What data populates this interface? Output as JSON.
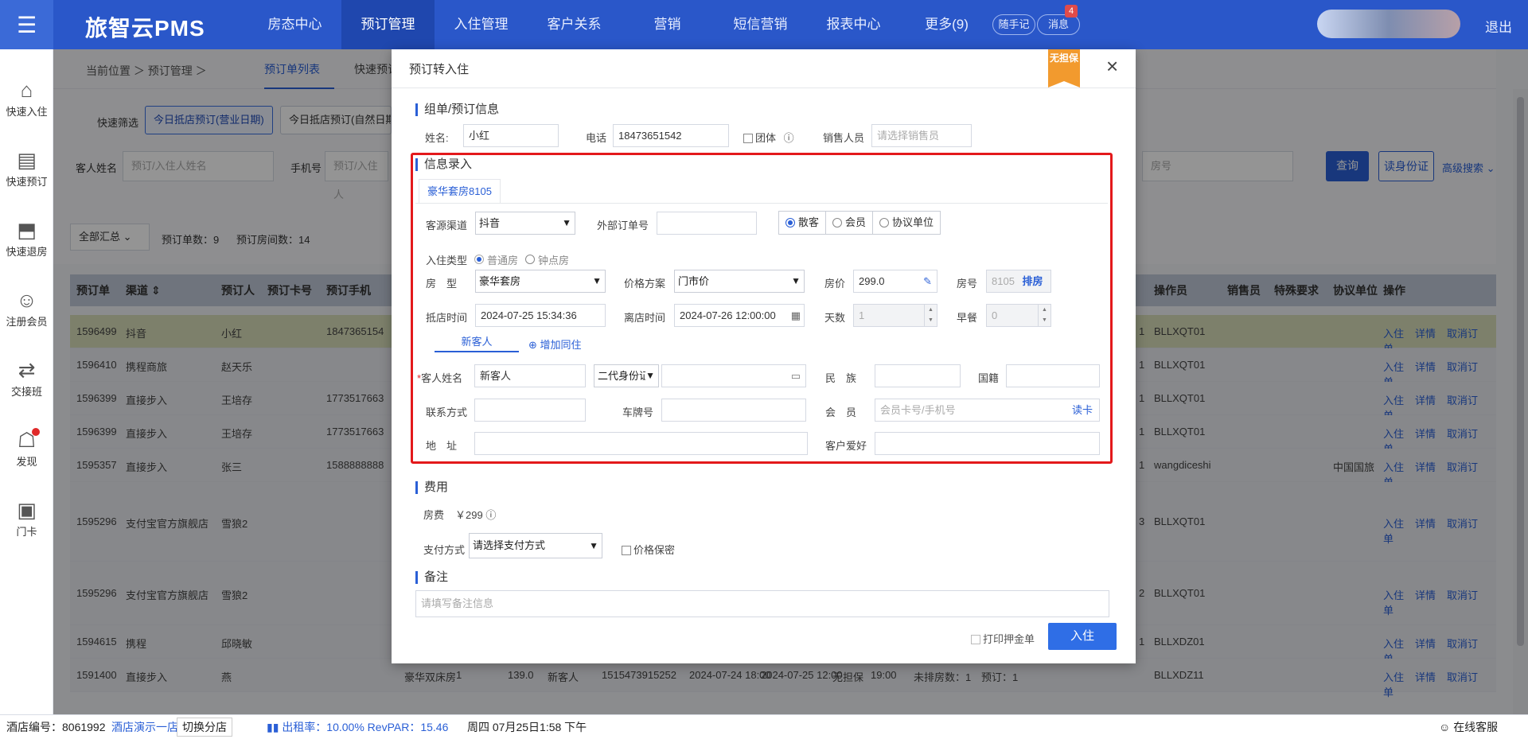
{
  "topbar": {
    "logo": "旅智云PMS",
    "nav": [
      "房态中心",
      "预订管理",
      "入住管理",
      "客户关系",
      "营销",
      "短信营销",
      "报表中心",
      "更多(9)"
    ],
    "memo_label": "随手记",
    "notice_label": "消息",
    "notice_count": "4",
    "logout_label": "退出"
  },
  "sidebar": {
    "items": [
      {
        "label": "快速入住",
        "icon": "home-icon"
      },
      {
        "label": "快速预订",
        "icon": "document-icon"
      },
      {
        "label": "快速退房",
        "icon": "checkout-icon"
      },
      {
        "label": "注册会员",
        "icon": "user-icon"
      },
      {
        "label": "交接班",
        "icon": "shift-icon"
      },
      {
        "label": "发现",
        "icon": "discover-icon"
      },
      {
        "label": "门卡",
        "icon": "card-icon"
      }
    ]
  },
  "breadcrumb": {
    "text": "当前位置 ＞ 预订管理 ＞",
    "tab_active": "预订单列表",
    "tab_other": "快速预订"
  },
  "filters": {
    "quick_label": "快速筛选",
    "btn1": "今日抵店预订(营业日期)",
    "btn2": "今日抵店预订(自然日期",
    "guest_label": "客人姓名",
    "guest_placeholder": "预订/入住人姓名",
    "phone_label": "手机号",
    "phone_placeholder": "预订/入住人",
    "room_placeholder": "房号",
    "query_label": "查询",
    "idcard_label": "读身份证",
    "advanced_label": "高级搜索",
    "summary_select": "全部汇总",
    "order_count": "预订单数：9",
    "room_count": "预订房间数：14"
  },
  "table": {
    "headers_left": [
      "预订单",
      "渠道",
      "预订人",
      "预订卡号",
      "预订手机"
    ],
    "headers_right": [
      "操作员",
      "销售员",
      "特殊要求",
      "协议单位",
      "操作"
    ],
    "op_labels": [
      "入住",
      "详情",
      "取消订单"
    ],
    "rows": [
      {
        "id": "1596499",
        "channel": "抖音",
        "name": "小红",
        "phone": "1847365154",
        "count": "1",
        "operator": "BLLXQT01",
        "agreement": ""
      },
      {
        "id": "1596410",
        "channel": "携程商旅",
        "name": "赵天乐",
        "phone": "",
        "count": "1",
        "operator": "BLLXQT01",
        "agreement": ""
      },
      {
        "id": "1596399",
        "channel": "直接步入",
        "name": "王培存",
        "phone": "1773517663",
        "count": "1",
        "operator": "BLLXQT01",
        "agreement": ""
      },
      {
        "id": "1596399",
        "channel": "直接步入",
        "name": "王培存",
        "phone": "1773517663",
        "count": "1",
        "operator": "BLLXQT01",
        "agreement": ""
      },
      {
        "id": "1595357",
        "channel": "直接步入",
        "name": "张三",
        "phone": "1588888888",
        "count": "1",
        "operator": "wangdiceshi",
        "agreement": "中国国旅"
      },
      {
        "id": "1595296",
        "channel": "支付宝官方旗舰店",
        "name": "雪狼2",
        "phone": "",
        "count": "3",
        "operator": "BLLXQT01",
        "agreement": ""
      },
      {
        "id": "1595296",
        "channel": "支付宝官方旗舰店",
        "name": "雪狼2",
        "phone": "",
        "count": "2",
        "operator": "BLLXQT01",
        "agreement": ""
      },
      {
        "id": "1594615",
        "channel": "携程",
        "name": "邱晓敏",
        "phone": "",
        "count": "1",
        "operator": "BLLXDZ01",
        "agreement": ""
      },
      {
        "id": "1591400",
        "channel": "直接步入",
        "name": "燕",
        "phone": "",
        "count": "",
        "operator": "BLLXDZ11",
        "agreement": ""
      }
    ],
    "row9_extra": [
      "豪华双床房",
      "1",
      "139.0",
      "新客人",
      "1515473915252",
      "2024-07-24 18:00",
      "2024-07-25 12:00",
      "无担保",
      "19:00",
      "未排房数：1",
      "预订：1"
    ]
  },
  "footer": {
    "hotel_no": "酒店编号：8061992",
    "hotel_name": "酒店演示一店",
    "switch_label": "切换分店",
    "occupancy": "出租率：10.00%  RevPAR：15.46",
    "datetime": "周四 07月25日1:58 下午",
    "support_label": "在线客服"
  },
  "modal": {
    "title": "预订转入住",
    "ribbon": "无担保",
    "sec_order": "组单/预订信息",
    "name_label": "姓名:",
    "name_value": "小红",
    "phone_label": "电话",
    "phone_value": "18473651542",
    "group_label": "团体",
    "sales_label": "销售人员",
    "sales_placeholder": "请选择销售员",
    "sec_info": "信息录入",
    "room_tab": "豪华套房8105",
    "source_label": "客源渠道",
    "source_value": "抖音",
    "ext_order_label": "外部订单号",
    "guest_types": [
      "散客",
      "会员",
      "协议单位"
    ],
    "checkin_type_label": "入住类型",
    "checkin_types": [
      "普通房",
      "钟点房"
    ],
    "room_type_label": "房　型",
    "room_type_value": "豪华套房",
    "price_plan_label": "价格方案",
    "price_plan_value": "门市价",
    "room_price_label": "房价",
    "room_price_value": "299.0",
    "room_no_label": "房号",
    "room_no_value": "8105",
    "arrange_label": "排房",
    "arrive_label": "抵店时间",
    "arrive_value": "2024-07-25 15:34:36",
    "depart_label": "离店时间",
    "depart_value": "2024-07-26 12:00:00",
    "days_label": "天数",
    "days_value": "1",
    "breakfast_label": "早餐",
    "breakfast_value": "0",
    "guest_tab": "新客人",
    "add_companion": "增加同住",
    "guest_name_label": "客人姓名",
    "guest_name_value": "新客人",
    "id_type_value": "二代身份证",
    "ethnicity_label": "民　族",
    "nationality_label": "国籍",
    "contact_label": "联系方式",
    "plate_label": "车牌号",
    "member_label": "会　员",
    "member_placeholder": "会员卡号/手机号",
    "read_card": "读卡",
    "address_label": "地　址",
    "preference_label": "客户爱好",
    "sec_fee": "费用",
    "fee_label": "房费",
    "fee_value": "￥299",
    "pay_label": "支付方式",
    "pay_placeholder": "请选择支付方式",
    "price_secret": "价格保密",
    "sec_remark": "备注",
    "remark_placeholder": "请填写备注信息",
    "print_deposit": "打印押金单",
    "checkin_btn": "入住"
  }
}
